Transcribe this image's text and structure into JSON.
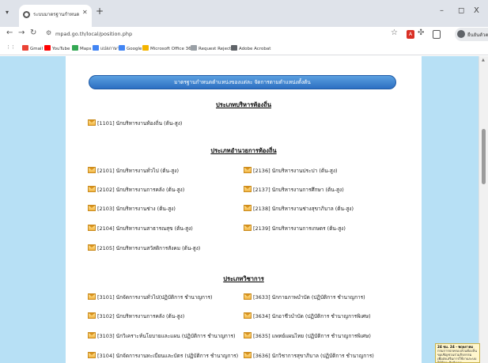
{
  "browser": {
    "tab_title": "ระบบมาตรฐานกำหนดตำแหน่ง - จัดการ",
    "new_tab": "+",
    "window_controls": {
      "minimize": "–",
      "restore": "◻",
      "close": "X"
    },
    "url": "mpad.go.th/local/position.php",
    "pdf_ext": "A",
    "profile_name": "ยืนยันตัวตน",
    "bookmarks": [
      {
        "label": "Gmail",
        "color": "#ea4335"
      },
      {
        "label": "YouTube",
        "color": "#ff0000"
      },
      {
        "label": "Maps",
        "color": "#34a853"
      },
      {
        "label": "แปลภาษา",
        "color": "#4285f4"
      },
      {
        "label": "Google",
        "color": "#4285f4"
      },
      {
        "label": "Microsoft Office 36...",
        "color": "#f4b400"
      },
      {
        "label": "Request Rejected",
        "color": "#9aa0a6"
      },
      {
        "label": "Adobe Acrobat",
        "color": "#5f6368"
      }
    ]
  },
  "page": {
    "banner": "มาตรฐานกำหนดตำแหน่งของแต่ละ จัดการตามตำแหน่งตั้งต้น",
    "sections": [
      {
        "title": "ประเภทบริหารท้องถิ่น"
      },
      {
        "title": "ประเภทอำนวยการท้องถิ่น"
      },
      {
        "title": "ประเภทวิชาการ"
      }
    ],
    "executive": [
      "[1101] นักบริหารงานท้องถิ่น (ต้น-สูง)"
    ],
    "management_left": [
      "[2101] นักบริหารงานทั่วไป (ต้น-สูง)",
      "[2102] นักบริหารงานการคลัง (ต้น-สูง)",
      "[2103] นักบริหารงานช่าง (ต้น-สูง)",
      "[2104] นักบริหารงานสาธารณสุข (ต้น-สูง)",
      "[2105] นักบริหารงานสวัสดิการสังคม (ต้น-สูง)"
    ],
    "management_right": [
      "[2136] นักบริหารงานประปา (ต้น-สูง)",
      "[2137] นักบริหารงานการศึกษา (ต้น-สูง)",
      "[2138] นักบริหารงานช่างสุขาภิบาล (ต้น-สูง)",
      "[2139] นักบริหารงานการเกษตร (ต้น-สูง)"
    ],
    "academic_left": [
      "[3101] นักจัดการงานทั่วไป(ปฏิบัติการ ชำนาญการ)",
      "[3102] นักบริหารงานการคลัง (ต้น-สูง)",
      "[3103] นักวิเคราะห์นโยบายและแผน (ปฏิบัติการ ชำนาญการ)",
      "[3104] นักจัดการงานทะเบียนและบัตร (ปฏิบัติการ ชำนาญการ)"
    ],
    "academic_right": [
      "[3633] นักกายภาพบำบัด (ปฏิบัติการ ชำนาญการ)",
      "[3634] นักอาชีวบำบัด (ปฏิบัติการ ชำนาญการพิเศษ)",
      "[3635] แพทย์แผนไทย (ปฏิบัติการ ชำนาญการพิเศษ)",
      "[3636] นักวิชาการสุขาภิบาล (ปฏิบัติการ ชำนาญการ)"
    ]
  },
  "notice": {
    "title": "24 ชม. 24 - พฤษภาคม",
    "body": "กรมการปกครองส่วนท้องถิ่นขอเชิญชวนร่วมกิจกรรม เพื่อส่งเสริมการใช้งานระบบให้มีประสิทธิภาพ"
  }
}
